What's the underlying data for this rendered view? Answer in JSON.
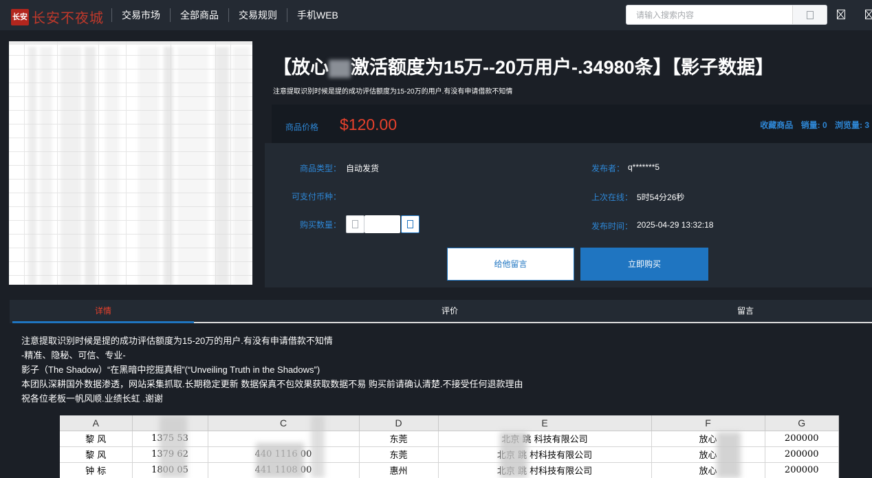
{
  "header": {
    "logo_text": "长安不夜城",
    "logo_mark": "长安",
    "nav": [
      "交易市场",
      "全部商品",
      "交易规则",
      "手机WEB"
    ],
    "search_placeholder": "请输入搜索内容"
  },
  "product": {
    "title_pre": "【放心",
    "title_post": "激活额度为15万--20万用户-.34980条】【影子数据】",
    "subtitle": "注意提取识别时候是提的成功评估额度为15-20万的用户.有没有申请借款不知情",
    "price_label": "商品价格",
    "price": "$120.00",
    "fav": "收藏商品",
    "sales": "销量: 0",
    "views": "浏览量: 3",
    "type_label": "商品类型：",
    "type_value": "自动发货",
    "currency_label": "可支付币种：",
    "qty_label": "购买数量：",
    "qty_value": "",
    "publisher_label": "发布者：",
    "publisher_value": "q*******5",
    "online_label": "上次在线：",
    "online_value": "5时54分26秒",
    "time_label": "发布时间：",
    "time_value": "2025-04-29 13:32:18",
    "btn_message": "给他留言",
    "btn_buy": "立即购买"
  },
  "tabs": [
    "详情",
    "评价",
    "留言"
  ],
  "description": [
    "注意提取识别时候是提的成功评估额度为15-20万的用户.有没有申请借款不知情",
    "-精准、隐秘、可信、专业-",
    "影子（The Shadow）“在黑暗中挖掘真相”(“Unveiling Truth in the Shadows”)",
    "本团队深耕国外数据渗透，网站采集抓取.长期稳定更新 数据保真不包效果获取数据不易 购买前请确认清楚.不接受任何退款理由",
    "祝各位老板一帆风顺.业绩长虹 .谢谢"
  ],
  "sheet": {
    "headers": [
      "A",
      "",
      "C",
      "D",
      "E",
      "F",
      "G"
    ],
    "rows": [
      [
        "黎  风",
        "1375   53",
        "",
        "东莞",
        "北京    跳    科技有限公司",
        "放心",
        "200000"
      ],
      [
        "黎  风",
        "1379   62",
        "440    1116  00",
        "东莞",
        "北京    跳    村科技有限公司",
        "放心",
        "200000"
      ],
      [
        "钟  标",
        "1800   05",
        "441    1108  00",
        "惠州",
        "北京    跳    村科技有限公司",
        "放心",
        "200000"
      ]
    ]
  }
}
